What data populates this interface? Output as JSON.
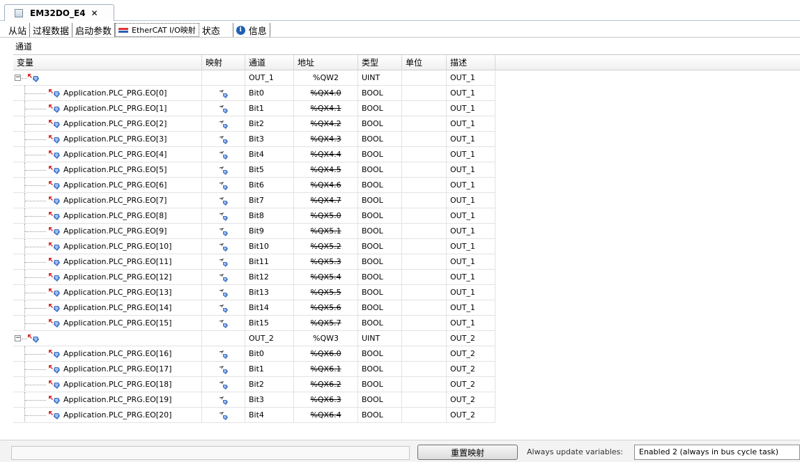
{
  "doc_tab": {
    "title": "EM32DO_E4",
    "close": "✕"
  },
  "subtabs": [
    {
      "label": "从站"
    },
    {
      "label": "过程数据"
    },
    {
      "label": "启动参数"
    },
    {
      "label": "EtherCAT I/O映射"
    },
    {
      "label": "状态"
    },
    {
      "label": "信息"
    }
  ],
  "section_label": "通道",
  "columns": [
    "变量",
    "映射",
    "通道",
    "地址",
    "类型",
    "单位",
    "描述"
  ],
  "rows": [
    {
      "kind": "parent",
      "variable": "",
      "channel": "OUT_1",
      "address": "%QW2",
      "type": "UINT",
      "unit": "",
      "desc": "OUT_1"
    },
    {
      "kind": "child",
      "variable": "Application.PLC_PRG.EO[0]",
      "channel": "Bit0",
      "address": "%QX4.0",
      "type": "BOOL",
      "unit": "",
      "desc": "OUT_1"
    },
    {
      "kind": "child",
      "variable": "Application.PLC_PRG.EO[1]",
      "channel": "Bit1",
      "address": "%QX4.1",
      "type": "BOOL",
      "unit": "",
      "desc": "OUT_1"
    },
    {
      "kind": "child",
      "variable": "Application.PLC_PRG.EO[2]",
      "channel": "Bit2",
      "address": "%QX4.2",
      "type": "BOOL",
      "unit": "",
      "desc": "OUT_1"
    },
    {
      "kind": "child",
      "variable": "Application.PLC_PRG.EO[3]",
      "channel": "Bit3",
      "address": "%QX4.3",
      "type": "BOOL",
      "unit": "",
      "desc": "OUT_1"
    },
    {
      "kind": "child",
      "variable": "Application.PLC_PRG.EO[4]",
      "channel": "Bit4",
      "address": "%QX4.4",
      "type": "BOOL",
      "unit": "",
      "desc": "OUT_1"
    },
    {
      "kind": "child",
      "variable": "Application.PLC_PRG.EO[5]",
      "channel": "Bit5",
      "address": "%QX4.5",
      "type": "BOOL",
      "unit": "",
      "desc": "OUT_1"
    },
    {
      "kind": "child",
      "variable": "Application.PLC_PRG.EO[6]",
      "channel": "Bit6",
      "address": "%QX4.6",
      "type": "BOOL",
      "unit": "",
      "desc": "OUT_1"
    },
    {
      "kind": "child",
      "variable": "Application.PLC_PRG.EO[7]",
      "channel": "Bit7",
      "address": "%QX4.7",
      "type": "BOOL",
      "unit": "",
      "desc": "OUT_1"
    },
    {
      "kind": "child",
      "variable": "Application.PLC_PRG.EO[8]",
      "channel": "Bit8",
      "address": "%QX5.0",
      "type": "BOOL",
      "unit": "",
      "desc": "OUT_1"
    },
    {
      "kind": "child",
      "variable": "Application.PLC_PRG.EO[9]",
      "channel": "Bit9",
      "address": "%QX5.1",
      "type": "BOOL",
      "unit": "",
      "desc": "OUT_1"
    },
    {
      "kind": "child",
      "variable": "Application.PLC_PRG.EO[10]",
      "channel": "Bit10",
      "address": "%QX5.2",
      "type": "BOOL",
      "unit": "",
      "desc": "OUT_1"
    },
    {
      "kind": "child",
      "variable": "Application.PLC_PRG.EO[11]",
      "channel": "Bit11",
      "address": "%QX5.3",
      "type": "BOOL",
      "unit": "",
      "desc": "OUT_1"
    },
    {
      "kind": "child",
      "variable": "Application.PLC_PRG.EO[12]",
      "channel": "Bit12",
      "address": "%QX5.4",
      "type": "BOOL",
      "unit": "",
      "desc": "OUT_1"
    },
    {
      "kind": "child",
      "variable": "Application.PLC_PRG.EO[13]",
      "channel": "Bit13",
      "address": "%QX5.5",
      "type": "BOOL",
      "unit": "",
      "desc": "OUT_1"
    },
    {
      "kind": "child",
      "variable": "Application.PLC_PRG.EO[14]",
      "channel": "Bit14",
      "address": "%QX5.6",
      "type": "BOOL",
      "unit": "",
      "desc": "OUT_1"
    },
    {
      "kind": "child",
      "variable": "Application.PLC_PRG.EO[15]",
      "channel": "Bit15",
      "address": "%QX5.7",
      "type": "BOOL",
      "unit": "",
      "desc": "OUT_1"
    },
    {
      "kind": "parent",
      "variable": "",
      "channel": "OUT_2",
      "address": "%QW3",
      "type": "UINT",
      "unit": "",
      "desc": "OUT_2"
    },
    {
      "kind": "child",
      "variable": "Application.PLC_PRG.EO[16]",
      "channel": "Bit0",
      "address": "%QX6.0",
      "type": "BOOL",
      "unit": "",
      "desc": "OUT_2"
    },
    {
      "kind": "child",
      "variable": "Application.PLC_PRG.EO[17]",
      "channel": "Bit1",
      "address": "%QX6.1",
      "type": "BOOL",
      "unit": "",
      "desc": "OUT_2"
    },
    {
      "kind": "child",
      "variable": "Application.PLC_PRG.EO[18]",
      "channel": "Bit2",
      "address": "%QX6.2",
      "type": "BOOL",
      "unit": "",
      "desc": "OUT_2"
    },
    {
      "kind": "child",
      "variable": "Application.PLC_PRG.EO[19]",
      "channel": "Bit3",
      "address": "%QX6.3",
      "type": "BOOL",
      "unit": "",
      "desc": "OUT_2"
    },
    {
      "kind": "child",
      "variable": "Application.PLC_PRG.EO[20]",
      "channel": "Bit4",
      "address": "%QX6.4",
      "type": "BOOL",
      "unit": "",
      "desc": "OUT_2"
    }
  ],
  "bottom": {
    "reset_label": "重置映射",
    "update_label": "Always update variables:",
    "update_value": "Enabled 2 (always in bus cycle task)"
  }
}
